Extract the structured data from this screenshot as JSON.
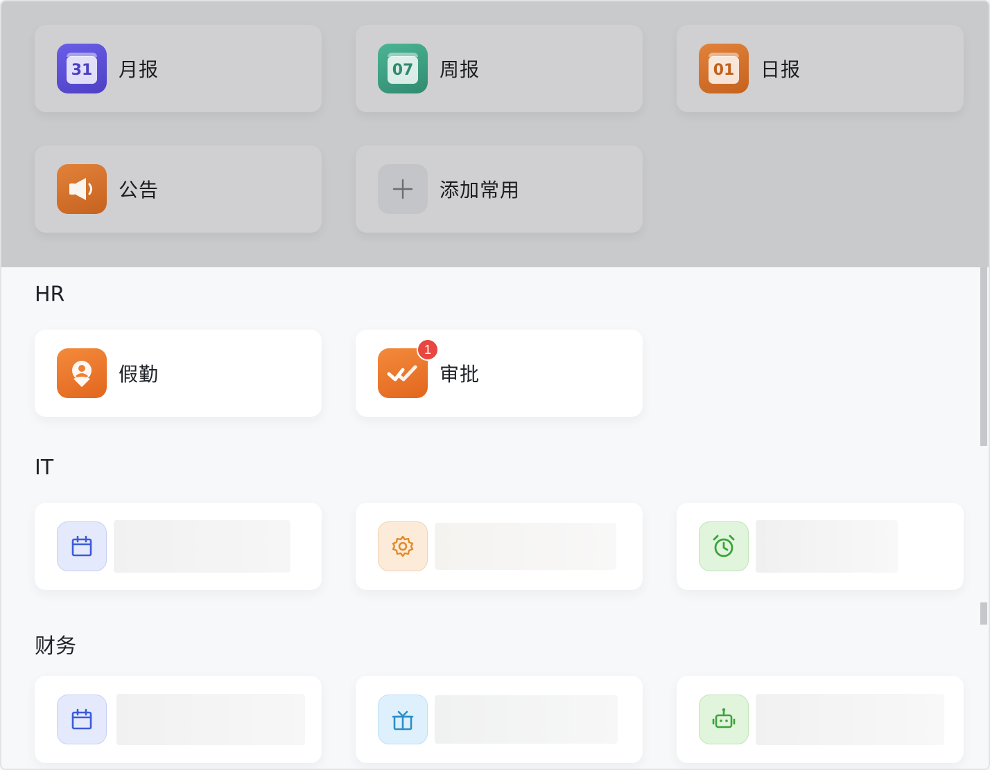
{
  "favorites": [
    {
      "label": "月报",
      "icon": "calendar-31-icon",
      "number": "31",
      "color": "#5b4fd6"
    },
    {
      "label": "周报",
      "icon": "calendar-07-icon",
      "number": "07",
      "color": "#3f9e82"
    },
    {
      "label": "日报",
      "icon": "calendar-01-icon",
      "number": "01",
      "color": "#d8742c"
    },
    {
      "label": "公告",
      "icon": "megaphone-icon",
      "color": "#d8742c"
    },
    {
      "label": "添加常用",
      "icon": "plus-icon"
    }
  ],
  "sections": [
    {
      "title": "HR",
      "items": [
        {
          "label": "假勤",
          "icon": "location-person-icon",
          "color": "#ef7a2f"
        },
        {
          "label": "审批",
          "icon": "double-check-icon",
          "color": "#ef7a2f",
          "badge": "1"
        }
      ]
    },
    {
      "title": "IT",
      "items": [
        {
          "icon": "calendar-icon",
          "color": "#3b5bd9"
        },
        {
          "icon": "gear-icon",
          "color": "#e08a2c"
        },
        {
          "icon": "alarm-clock-icon",
          "color": "#3aa33a"
        }
      ]
    },
    {
      "title": "财务",
      "items": [
        {
          "icon": "calendar-icon",
          "color": "#3b5bd9"
        },
        {
          "icon": "gift-icon",
          "color": "#2b8fc7"
        },
        {
          "icon": "robot-icon",
          "color": "#3aa33a"
        }
      ]
    }
  ]
}
